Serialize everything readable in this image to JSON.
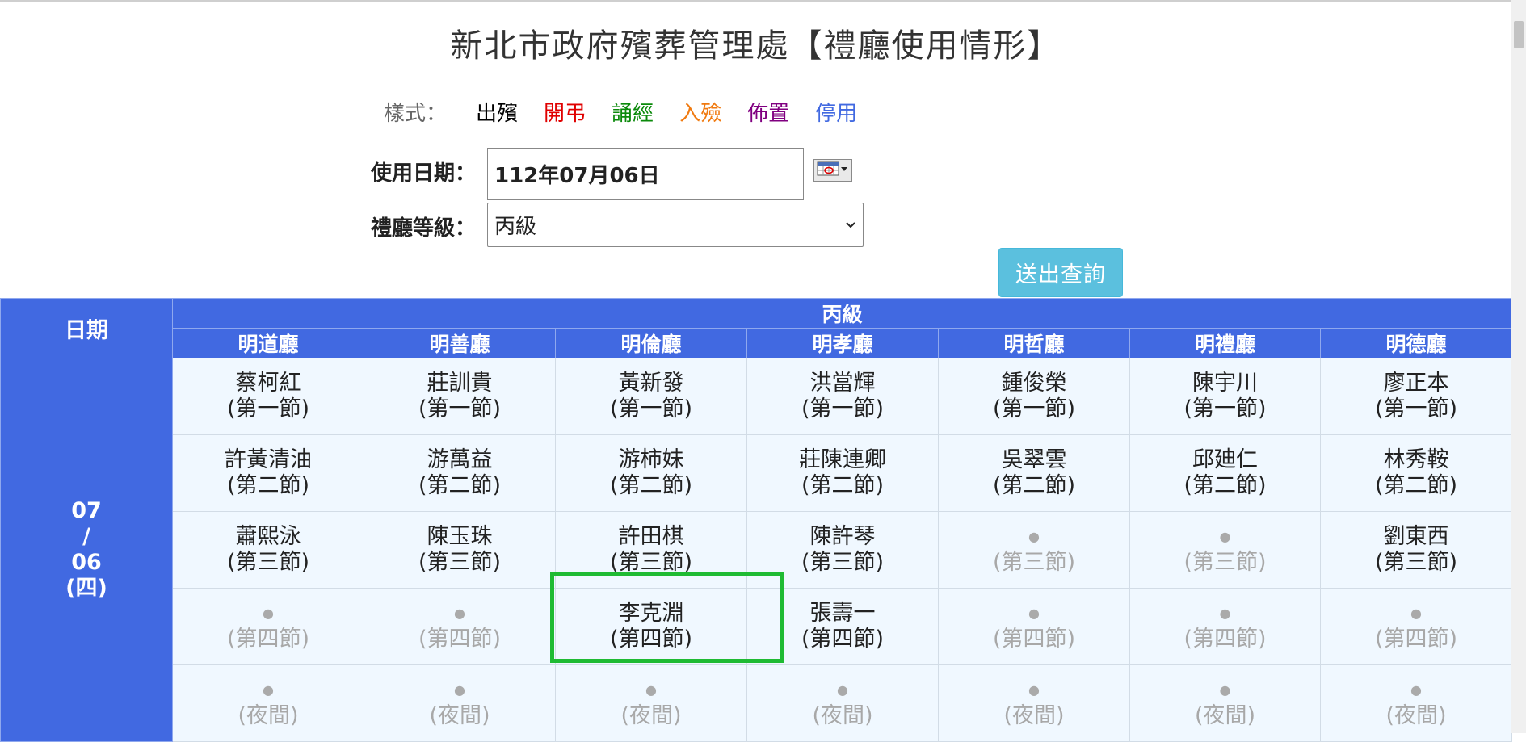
{
  "page": {
    "title": "新北市政府殯葬管理處【禮廳使用情形】"
  },
  "legend": {
    "label": "樣式：",
    "items": [
      {
        "text": "出殯",
        "color": "#000000"
      },
      {
        "text": "開弔",
        "color": "#e00000"
      },
      {
        "text": "誦經",
        "color": "#0b8a0b"
      },
      {
        "text": "入殮",
        "color": "#f07a10"
      },
      {
        "text": "佈置",
        "color": "#800080"
      },
      {
        "text": "停用",
        "color": "#4169e1"
      }
    ]
  },
  "form": {
    "date_label": "使用日期：",
    "date_value": "112年07月06日",
    "calendar_icon": "calendar-icon",
    "level_label": "禮廳等級：",
    "level_value": "丙級",
    "submit_label": "送出查詢"
  },
  "table": {
    "date_header": "日期",
    "level_header": "丙級",
    "halls": [
      "明道廳",
      "明善廳",
      "明倫廳",
      "明孝廳",
      "明哲廳",
      "明禮廳",
      "明德廳"
    ],
    "date": {
      "month": "07",
      "sep": "/",
      "day": "06",
      "weekday": "(四)"
    },
    "rows": [
      {
        "period": "(第一節)",
        "cells": [
          "蔡柯紅",
          "莊訓貴",
          "黃新發",
          "洪當輝",
          "鍾俊榮",
          "陳宇川",
          "廖正本"
        ]
      },
      {
        "period": "(第二節)",
        "cells": [
          "許黃清油",
          "游萬益",
          "游柿妹",
          "莊陳連卿",
          "吳翠雲",
          "邱廸仁",
          "林秀鞍"
        ]
      },
      {
        "period": "(第三節)",
        "cells": [
          "蕭熙泳",
          "陳玉珠",
          "許田棋",
          "陳許琴",
          "",
          "",
          "劉東西"
        ]
      },
      {
        "period": "(第四節)",
        "cells": [
          "",
          "",
          "李克淵",
          "張壽一",
          "",
          "",
          ""
        ]
      },
      {
        "period": "(夜間)",
        "cells": [
          "",
          "",
          "",
          "",
          "",
          "",
          ""
        ]
      }
    ],
    "empty_marker": "●"
  },
  "colors": {
    "header_blue": "#4169e1",
    "cell_bg": "#f0f8ff",
    "submit": "#5bc0de",
    "highlight": "#1fbb33"
  }
}
